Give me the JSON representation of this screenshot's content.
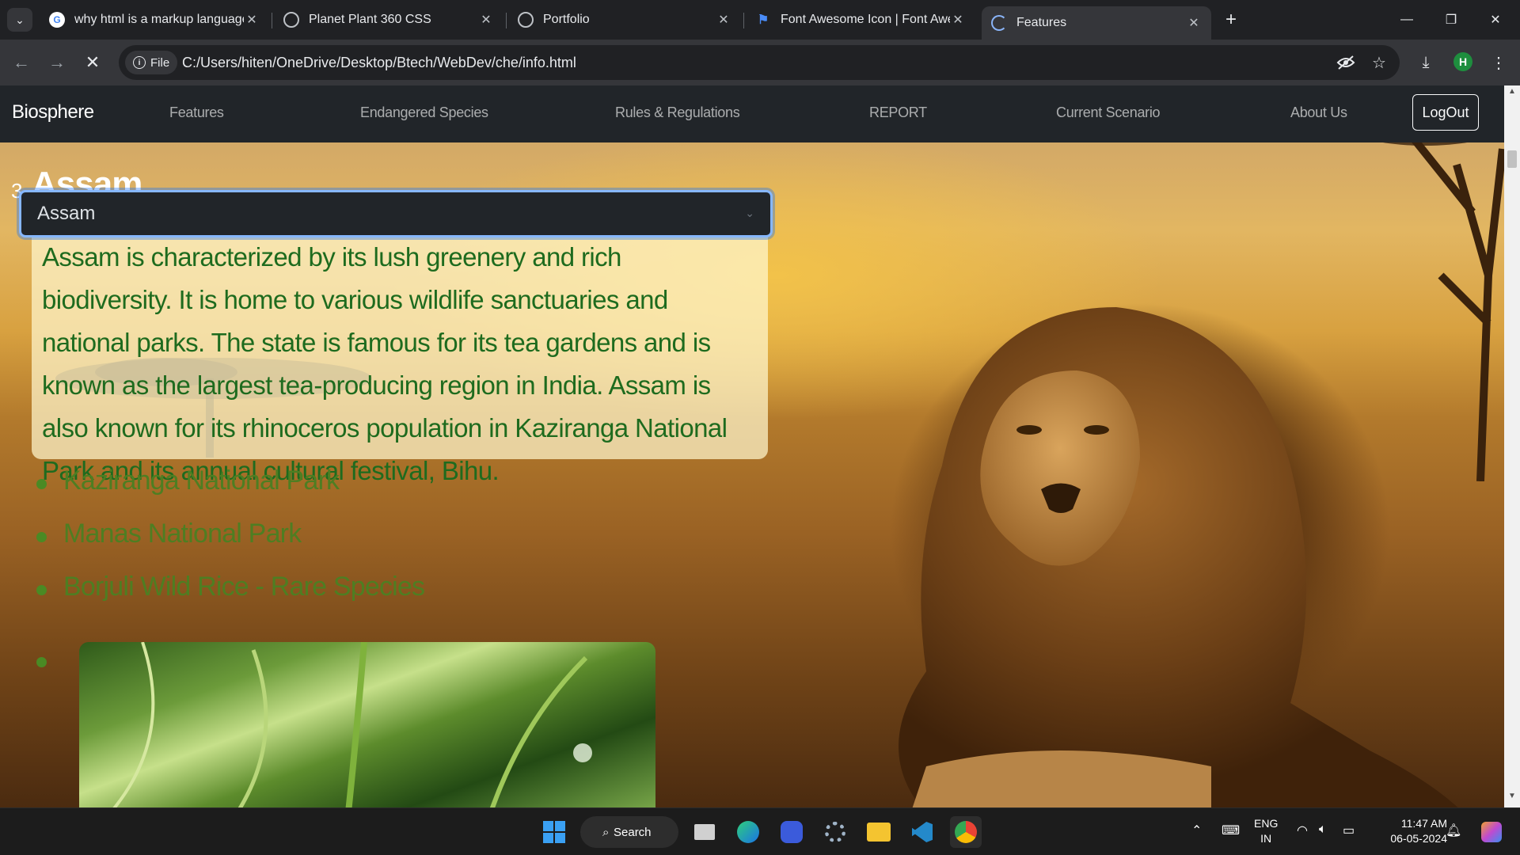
{
  "browser": {
    "tabs": [
      {
        "title": "why html is a markup language",
        "icon": "google-icon"
      },
      {
        "title": "Planet Plant 360 CSS",
        "icon": "globe-icon"
      },
      {
        "title": "Portfolio",
        "icon": "globe-icon"
      },
      {
        "title": "Font Awesome Icon | Font Awesome",
        "icon": "flag-icon"
      },
      {
        "title": "Features",
        "icon": "loading-icon"
      }
    ],
    "active_tab": 4,
    "chip_label": "File",
    "url": "C:/Users/hiten/OneDrive/Desktop/Btech/WebDev/che/info.html",
    "profile_initial": "H"
  },
  "site": {
    "brand": "Biosphere",
    "nav": [
      "Features",
      "Endangered Species",
      "Rules & Regulations",
      "REPORT",
      "Current Scenario",
      "About Us"
    ],
    "logout_label": "LogOut"
  },
  "content": {
    "heading_number": "3",
    "heading": "Assam",
    "selected_state": "Assam",
    "description": "Assam is characterized by its lush greenery and rich biodiversity. It is home to various wildlife sanctuaries and national parks. The state is famous for its tea gardens and is known as the largest tea-producing region in India. Assam is also known for its rhinoceros population in Kaziranga National Park and its annual cultural festival, Bihu.",
    "items": [
      "Kaziranga National Park",
      "Manas National Park",
      "Borjuli Wild Rice - Rare Species"
    ]
  },
  "taskbar": {
    "search_label": "Search",
    "lang_line1": "ENG",
    "lang_line2": "IN",
    "time": "11:47 AM",
    "date": "06-05-2024"
  },
  "colors": {
    "navbar": "#212529",
    "description_text": "#1e6b1e",
    "list_text": "#4e7e22",
    "card_bg": "#fff6cd"
  }
}
